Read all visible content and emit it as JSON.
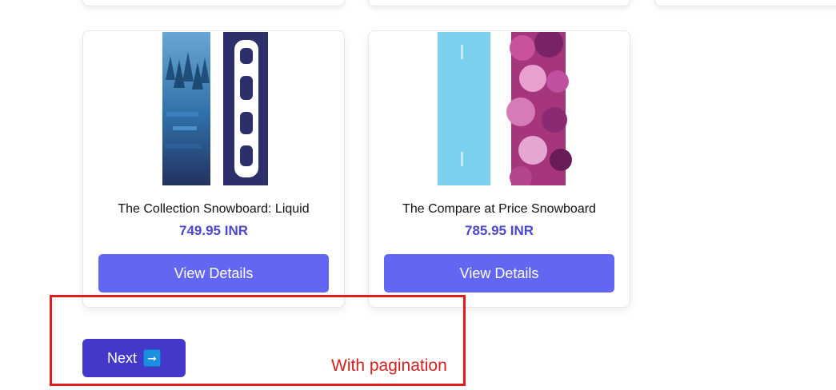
{
  "products": [
    {
      "title": "The Collection Snowboard: Liquid",
      "price": "749.95 INR",
      "button_label": "View Details",
      "image": "snowboard-liquid"
    },
    {
      "title": "The Compare at Price Snowboard",
      "price": "785.95 INR",
      "button_label": "View Details",
      "image": "snowboard-compare"
    }
  ],
  "pagination": {
    "next_label": "Next",
    "next_icon": "right-arrow-icon"
  },
  "annotation": {
    "text": "With pagination",
    "color": "#e21c1c"
  },
  "colors": {
    "button": "#6366f1",
    "next_button": "#4338ca",
    "price": "#4f46c9"
  }
}
